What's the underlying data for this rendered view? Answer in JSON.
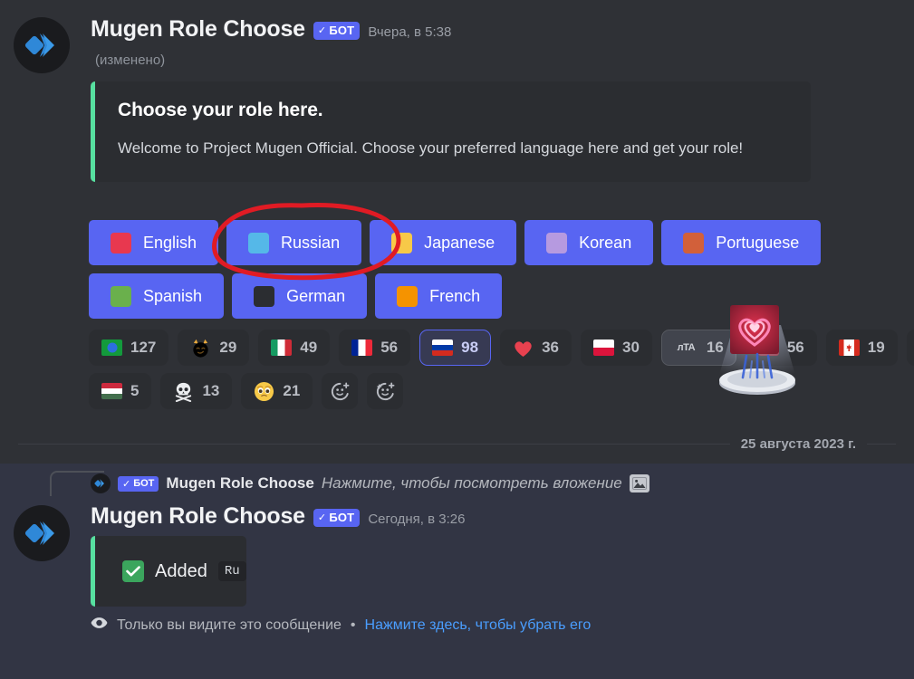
{
  "theme": {
    "bg": "#2f3136",
    "embed_bg": "#2b2d31",
    "blurple": "#5865f2",
    "embed_accent": "#57e0a0",
    "ephemeral_bg": "#323544",
    "link_blue": "#4a9eff",
    "annotation_color": "#e01b24"
  },
  "message1": {
    "author": "Mugen Role Choose",
    "bot_tag": "БОТ",
    "bot_check": "✓",
    "timestamp": "Вчера, в 5:38",
    "edited": "(изменено)",
    "avatar_icon": "mugen-logo-icon",
    "embed": {
      "title": "Choose your role here.",
      "description": "Welcome to Project Mugen Official. Choose your preferred language here and get your role!"
    },
    "button_rows": [
      [
        {
          "label": "English",
          "swatch": "#e8384f",
          "icon": "red-square-icon"
        },
        {
          "label": "Russian",
          "swatch": "#55b8e8",
          "icon": "blue-square-icon"
        },
        {
          "label": "Japanese",
          "swatch": "#f5c councils",
          "icon": "yellow-square-icon"
        },
        {
          "label": "Korean",
          "swatch": "#b69ae0",
          "icon": "purple-square-icon"
        },
        {
          "label": "Portuguese",
          "swatch": "#d2603a",
          "icon": "orange-square-icon"
        }
      ],
      [
        {
          "label": "Spanish",
          "swatch": "#6ab04c",
          "icon": "green-square-icon"
        },
        {
          "label": "German",
          "swatch": "#2b2d31",
          "icon": "black-square-icon"
        },
        {
          "label": "French",
          "swatch": "#f59300",
          "icon": "orange-square-icon"
        }
      ]
    ],
    "reaction_rows": [
      [
        {
          "emoji": "flag-brazil",
          "count": "127",
          "state": "normal"
        },
        {
          "emoji": "smirk-cat",
          "count": "29",
          "state": "normal"
        },
        {
          "emoji": "flag-italy",
          "count": "49",
          "state": "normal"
        },
        {
          "emoji": "flag-france",
          "count": "56",
          "state": "normal"
        },
        {
          "emoji": "flag-russia",
          "count": "98",
          "state": "selected"
        },
        {
          "emoji": "red-heart",
          "count": "36",
          "state": "normal"
        },
        {
          "emoji": "flag-poland",
          "count": "30",
          "state": "normal"
        },
        {
          "emoji": "jta-badge",
          "count": "16",
          "state": "hovered"
        },
        {
          "emoji": "heart-hologram",
          "count": "56",
          "state": "normal"
        },
        {
          "emoji": "flag-canada",
          "count": "19",
          "state": "normal"
        },
        {
          "emoji": "flag-indonesia",
          "count": "",
          "state": "clipped"
        }
      ],
      [
        {
          "emoji": "flag-hungary",
          "count": "5",
          "state": "normal"
        },
        {
          "emoji": "skull-crossbones",
          "count": "13",
          "state": "normal"
        },
        {
          "emoji": "pleading-face",
          "count": "21",
          "state": "normal"
        }
      ]
    ],
    "add_reaction_buttons": [
      "add-reaction-icon",
      "add-super-reaction-icon"
    ]
  },
  "date_divider": "25 августа 2023 г.",
  "message2": {
    "reply_reference": {
      "bot_tag": "БОТ",
      "bot_check": "✓",
      "author": "Mugen Role Choose",
      "text": "Нажмите, чтобы посмотреть вложение",
      "attachment_icon": "image-attachment-icon"
    },
    "author": "Mugen Role Choose",
    "bot_tag": "БОТ",
    "bot_check": "✓",
    "timestamp": "Сегодня, в 3:26",
    "avatar_icon": "mugen-logo-icon",
    "embed": {
      "check_icon": "green-check-icon",
      "label": "Added",
      "code_chip": "Ru"
    },
    "ephemeral_notice": {
      "eye_icon": "eye-icon",
      "text": "Только вы видите это сообщение",
      "separator": "•",
      "link": "Нажмите здесь, чтобы убрать его"
    }
  }
}
